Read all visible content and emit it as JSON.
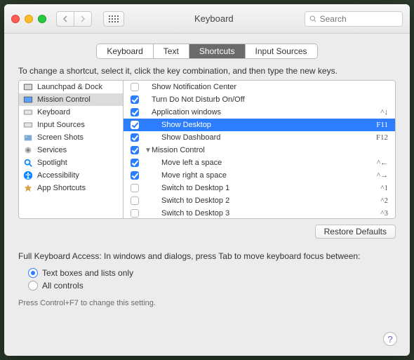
{
  "window": {
    "title": "Keyboard"
  },
  "search": {
    "placeholder": "Search"
  },
  "tabs": [
    "Keyboard",
    "Text",
    "Shortcuts",
    "Input Sources"
  ],
  "active_tab": 2,
  "instruction": "To change a shortcut, select it, click the key combination, and then type the new keys.",
  "categories": [
    {
      "label": "Launchpad & Dock",
      "icon": "launchpad"
    },
    {
      "label": "Mission Control",
      "icon": "mission",
      "selected": true
    },
    {
      "label": "Keyboard",
      "icon": "keyboard"
    },
    {
      "label": "Input Sources",
      "icon": "input"
    },
    {
      "label": "Screen Shots",
      "icon": "screenshot"
    },
    {
      "label": "Services",
      "icon": "services"
    },
    {
      "label": "Spotlight",
      "icon": "spotlight"
    },
    {
      "label": "Accessibility",
      "icon": "accessibility"
    },
    {
      "label": "App Shortcuts",
      "icon": "appshortcut"
    }
  ],
  "shortcuts": [
    {
      "checked": false,
      "indent": 1,
      "label": "Show Notification Center",
      "key": ""
    },
    {
      "checked": true,
      "indent": 1,
      "label": "Turn Do Not Disturb On/Off",
      "key": ""
    },
    {
      "checked": true,
      "indent": 1,
      "label": "Application windows",
      "key": "^↓"
    },
    {
      "checked": true,
      "indent": 2,
      "label": "Show Desktop",
      "key": "F11",
      "selected": true
    },
    {
      "checked": true,
      "indent": 2,
      "label": "Show Dashboard",
      "key": "F12"
    },
    {
      "checked": true,
      "indent": 1,
      "label": "Mission Control",
      "key": "",
      "disclosure": "open"
    },
    {
      "checked": true,
      "indent": 2,
      "label": "Move left a space",
      "key": "^←"
    },
    {
      "checked": true,
      "indent": 2,
      "label": "Move right a space",
      "key": "^→"
    },
    {
      "checked": false,
      "indent": 2,
      "label": "Switch to Desktop 1",
      "key": "^1"
    },
    {
      "checked": false,
      "indent": 2,
      "label": "Switch to Desktop 2",
      "key": "^2"
    },
    {
      "checked": false,
      "indent": 2,
      "label": "Switch to Desktop 3",
      "key": "^3"
    }
  ],
  "restore_label": "Restore Defaults",
  "access_label": "Full Keyboard Access: In windows and dialogs, press Tab to move keyboard focus between:",
  "radios": [
    {
      "label": "Text boxes and lists only",
      "on": true
    },
    {
      "label": "All controls",
      "on": false
    }
  ],
  "hint": "Press Control+F7 to change this setting.",
  "help": "?"
}
